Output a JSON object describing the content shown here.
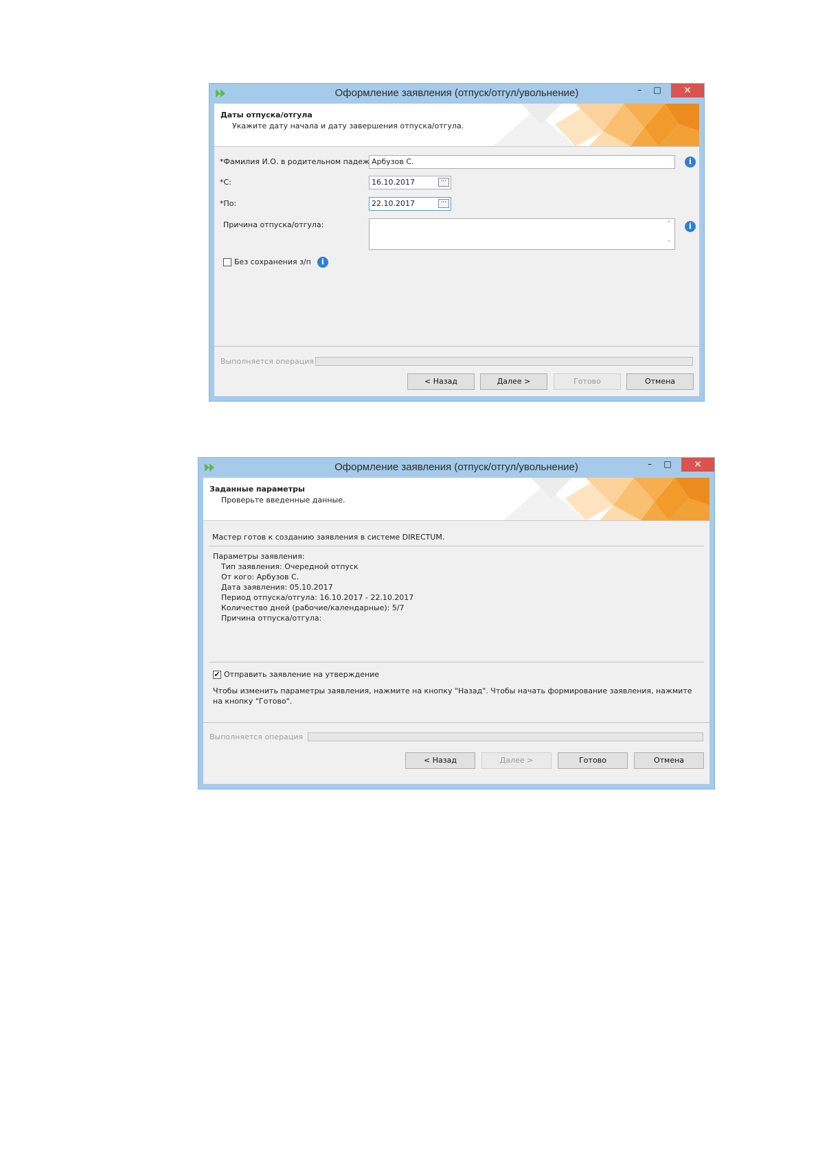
{
  "window1": {
    "title": "Оформление заявления (отпуск/отгул/увольнение)",
    "minimize": "–",
    "maximize": "□",
    "close": "✕",
    "header": {
      "title": "Даты отпуска/отгула",
      "subtitle": "Укажите дату начала и дату завершения отпуска/отгула."
    },
    "fields": {
      "name_label": "*Фамилия И.О. в родительном падеже:",
      "name_value": "Арбузов С.",
      "from_label": "*С:",
      "from_value": "16.10.2017",
      "to_label": "*По:",
      "to_value": "22.10.2017",
      "reason_label": "Причина отпуска/отгула:",
      "reason_value": "",
      "unpaid_label": "Без сохранения з/п",
      "unpaid_checked": false,
      "date_button": "···"
    },
    "operation_label": "Выполняется операция",
    "buttons": {
      "back": "< Назад",
      "next": "Далее >",
      "finish": "Готово",
      "cancel": "Отмена"
    }
  },
  "window2": {
    "title": "Оформление заявления (отпуск/отгул/увольнение)",
    "minimize": "–",
    "maximize": "□",
    "close": "✕",
    "header": {
      "title": "Заданные параметры",
      "subtitle": "Проверьте введенные данные."
    },
    "ready_text": "Мастер готов к созданию заявления в системе DIRECTUM.",
    "params_title": "Параметры заявления:",
    "params": [
      "Тип заявления:  Очередной отпуск",
      "От кого:  Арбузов С.",
      "Дата заявления:  05.10.2017",
      "Период отпуска/отгула:  16.10.2017 - 22.10.2017",
      "Количество дней (рабочие/календарные):  5/7",
      "Причина отпуска/отгула:"
    ],
    "send_label": "Отправить заявление на утверждение",
    "send_checked": true,
    "check_mark": "✔",
    "hint": "Чтобы изменить параметры заявления, нажмите на кнопку \"Назад\". Чтобы начать формирование заявления, нажмите на кнопку \"Готово\".",
    "operation_label": "Выполняется операция",
    "buttons": {
      "back": "< Назад",
      "next": "Далее >",
      "finish": "Готово",
      "cancel": "Отмена"
    }
  },
  "colors": {
    "titlebar": "#a6cbea",
    "close": "#d9534f",
    "accent_orange": "#f29b2a",
    "info": "#2f7fd1"
  }
}
